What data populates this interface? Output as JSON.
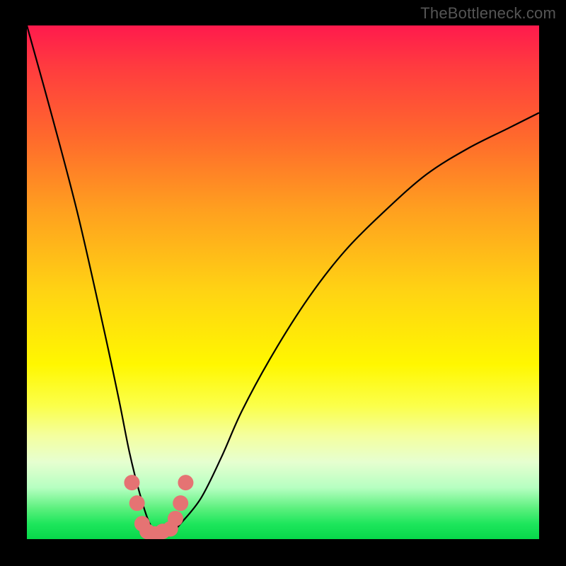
{
  "watermark": "TheBottleneck.com",
  "colors": {
    "frame": "#000000",
    "curve": "#000000",
    "dot": "#e57373",
    "gradient_top": "#ff1a4d",
    "gradient_bottom": "#07d84a"
  },
  "chart_data": {
    "type": "line",
    "title": "",
    "xlabel": "",
    "ylabel": "",
    "xlim": [
      0,
      100
    ],
    "ylim": [
      0,
      100
    ],
    "grid": false,
    "series": [
      {
        "name": "bottleneck-curve",
        "note": "V-shaped curve; y is bottleneck percentage (0 = good/green, 100 = bad/red). Values estimated from pixel positions since no axis ticks are shown.",
        "x": [
          0,
          5,
          10,
          15,
          18,
          20,
          22,
          24,
          26,
          28,
          30,
          34,
          38,
          42,
          48,
          55,
          62,
          70,
          78,
          86,
          94,
          100
        ],
        "y": [
          100,
          82,
          63,
          41,
          27,
          17,
          9,
          3,
          1,
          1,
          3,
          8,
          16,
          25,
          36,
          47,
          56,
          64,
          71,
          76,
          80,
          83
        ]
      }
    ],
    "points": {
      "name": "sample-points",
      "note": "Salmon dots near curve trough; coords estimated.",
      "x": [
        20.5,
        21.5,
        22.5,
        23.5,
        25.0,
        26.5,
        28.0,
        29.0,
        30.0,
        31.0
      ],
      "y": [
        11,
        7,
        3,
        1.5,
        1,
        1.5,
        2,
        4,
        7,
        11
      ]
    },
    "background_gradient": {
      "orientation": "vertical",
      "stops": [
        {
          "pos": 0.0,
          "color": "#ff1a4d"
        },
        {
          "pos": 0.22,
          "color": "#ff6a2c"
        },
        {
          "pos": 0.52,
          "color": "#ffd413"
        },
        {
          "pos": 0.74,
          "color": "#fbff4a"
        },
        {
          "pos": 0.9,
          "color": "#b6ffc1"
        },
        {
          "pos": 1.0,
          "color": "#07d84a"
        }
      ]
    }
  }
}
